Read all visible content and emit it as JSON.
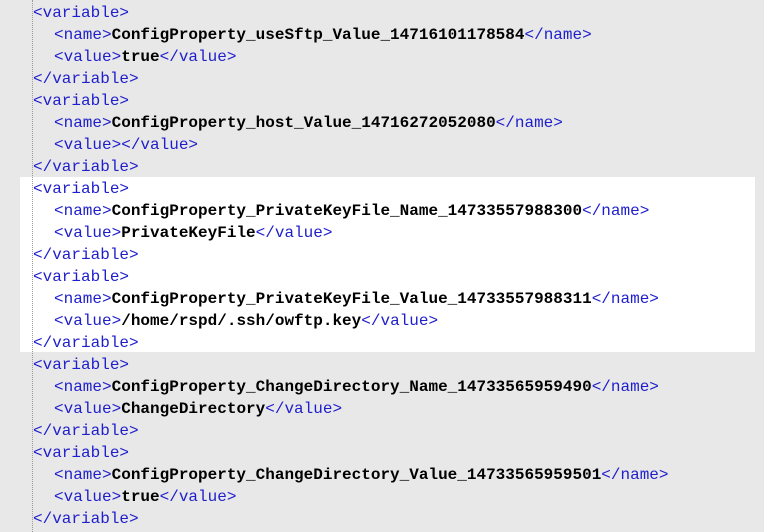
{
  "colors": {
    "background": "#e8e8e8",
    "highlight": "#ffffff",
    "tag": "#1e1ecc",
    "text": "#000000"
  },
  "tags": {
    "variable_open": "<variable>",
    "variable_close": "</variable>",
    "name_open": "<name>",
    "name_close": "</name>",
    "value_open": "<value>",
    "value_close": "</value>"
  },
  "variables": [
    {
      "name": "ConfigProperty_useSftp_Value_14716101178584",
      "value": "true"
    },
    {
      "name": "ConfigProperty_host_Value_14716272052080",
      "value": ""
    },
    {
      "name": "ConfigProperty_PrivateKeyFile_Name_14733557988300",
      "value": "PrivateKeyFile"
    },
    {
      "name": "ConfigProperty_PrivateKeyFile_Value_14733557988311",
      "value": "/home/rspd/.ssh/owftp.key"
    },
    {
      "name": "ConfigProperty_ChangeDirectory_Name_14733565959490",
      "value": "ChangeDirectory"
    },
    {
      "name": "ConfigProperty_ChangeDirectory_Value_14733565959501",
      "value": "true"
    }
  ]
}
